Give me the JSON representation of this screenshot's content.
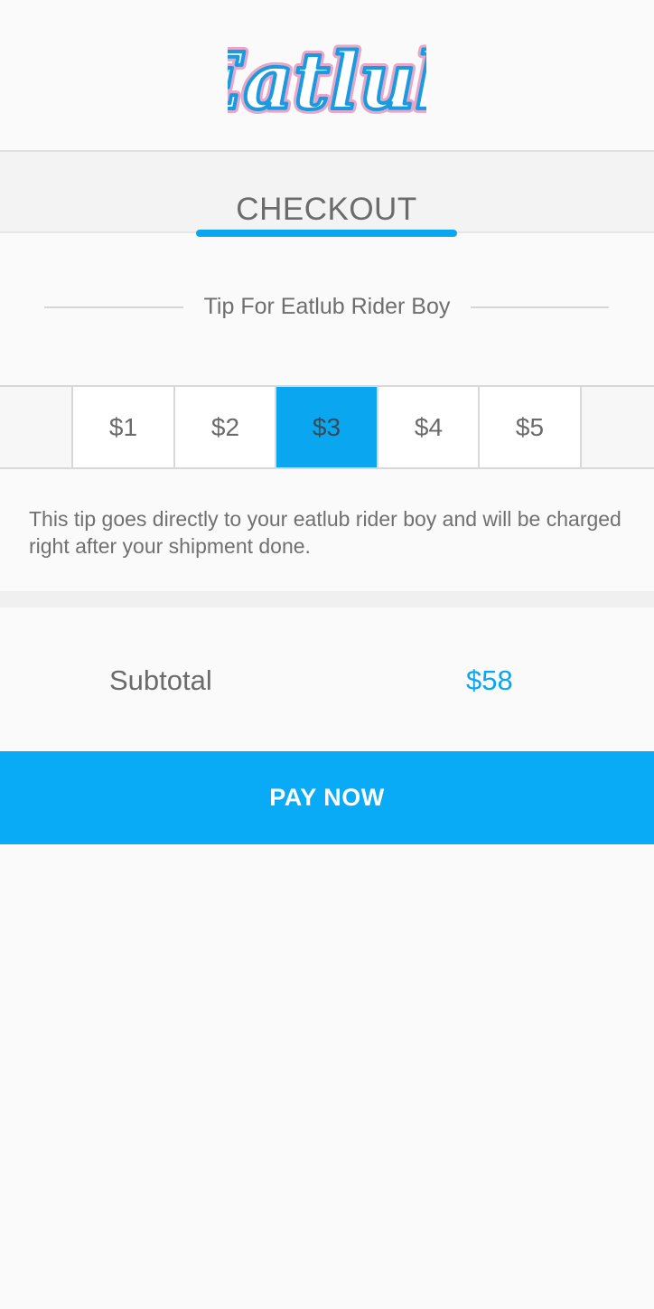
{
  "header": {
    "logo_text": "Eatlub"
  },
  "tabs": [
    {
      "label": "CHECKOUT",
      "active": true
    }
  ],
  "tip": {
    "heading": "Tip For Eatlub Rider Boy",
    "options": [
      "$1",
      "$2",
      "$3",
      "$4",
      "$5"
    ],
    "selected_index": 2,
    "note": "This tip goes directly to your eatlub rider boy and will be charged right after your shipment done."
  },
  "summary": {
    "subtotal_label": "Subtotal",
    "subtotal_value": "$58"
  },
  "actions": {
    "pay_label": "PAY NOW"
  },
  "colors": {
    "accent": "#0aa6f0",
    "button": "#09abf7",
    "logo_pink": "#e8a6c9"
  }
}
